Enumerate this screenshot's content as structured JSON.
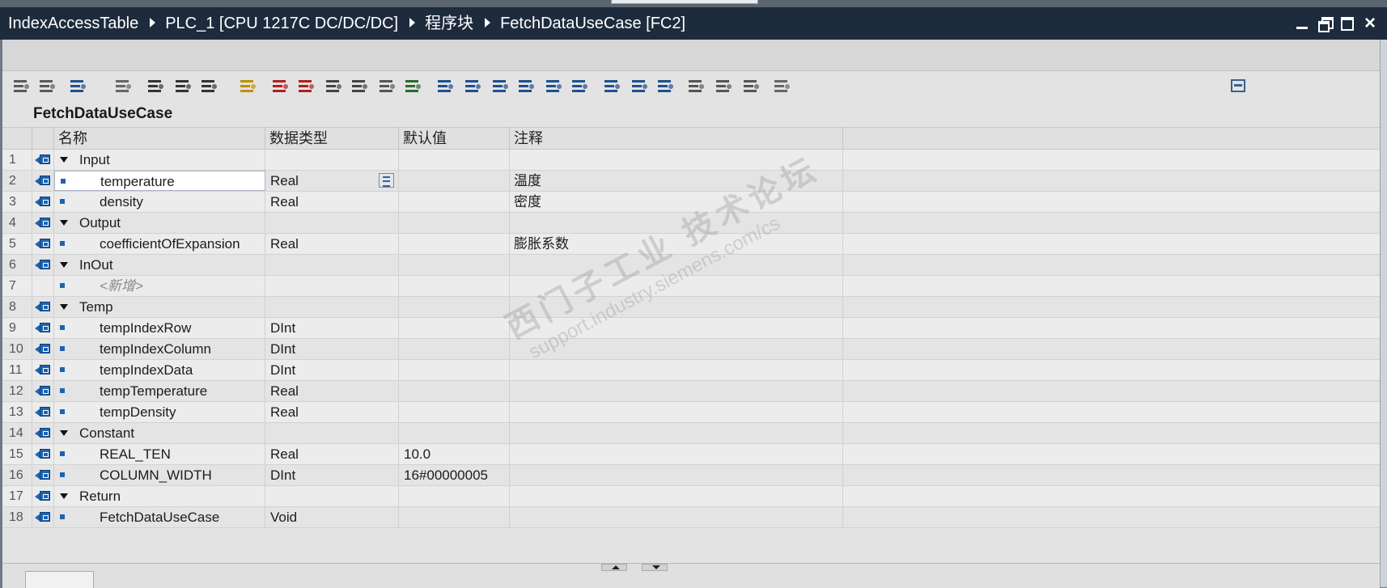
{
  "breadcrumb": [
    "IndexAccessTable",
    "PLC_1 [CPU 1217C DC/DC/DC]",
    "程序块",
    "FetchDataUseCase [FC2]"
  ],
  "block_name": "FetchDataUseCase",
  "columns": {
    "name": "名称",
    "type": "数据类型",
    "default": "默认值",
    "comment": "注释"
  },
  "rows": [
    {
      "num": "1",
      "kind": "group",
      "name": "Input",
      "type": "",
      "default": "",
      "comment": ""
    },
    {
      "num": "2",
      "kind": "var",
      "name": "temperature",
      "type": "Real",
      "default": "",
      "comment": "温度",
      "selected": true
    },
    {
      "num": "3",
      "kind": "var",
      "name": "density",
      "type": "Real",
      "default": "",
      "comment": "密度"
    },
    {
      "num": "4",
      "kind": "group",
      "name": "Output",
      "type": "",
      "default": "",
      "comment": ""
    },
    {
      "num": "5",
      "kind": "var",
      "name": "coefficientOfExpansion",
      "type": "Real",
      "default": "",
      "comment": "膨胀系数"
    },
    {
      "num": "6",
      "kind": "group",
      "name": "InOut",
      "type": "",
      "default": "",
      "comment": ""
    },
    {
      "num": "7",
      "kind": "new",
      "name": "<新增>",
      "type": "",
      "default": "",
      "comment": ""
    },
    {
      "num": "8",
      "kind": "group",
      "name": "Temp",
      "type": "",
      "default": "",
      "comment": ""
    },
    {
      "num": "9",
      "kind": "var",
      "name": "tempIndexRow",
      "type": "DInt",
      "default": "",
      "comment": ""
    },
    {
      "num": "10",
      "kind": "var",
      "name": "tempIndexColumn",
      "type": "DInt",
      "default": "",
      "comment": ""
    },
    {
      "num": "11",
      "kind": "var",
      "name": "tempIndexData",
      "type": "DInt",
      "default": "",
      "comment": ""
    },
    {
      "num": "12",
      "kind": "var",
      "name": "tempTemperature",
      "type": "Real",
      "default": "",
      "comment": ""
    },
    {
      "num": "13",
      "kind": "var",
      "name": "tempDensity",
      "type": "Real",
      "default": "",
      "comment": ""
    },
    {
      "num": "14",
      "kind": "group",
      "name": "Constant",
      "type": "",
      "default": "",
      "comment": ""
    },
    {
      "num": "15",
      "kind": "var",
      "name": "REAL_TEN",
      "type": "Real",
      "default": "10.0",
      "comment": ""
    },
    {
      "num": "16",
      "kind": "var",
      "name": "COLUMN_WIDTH",
      "type": "DInt",
      "default": "16#00000005",
      "comment": ""
    },
    {
      "num": "17",
      "kind": "group",
      "name": "Return",
      "type": "",
      "default": "",
      "comment": ""
    },
    {
      "num": "18",
      "kind": "var",
      "name": "FetchDataUseCase",
      "type": "Void",
      "default": "",
      "comment": ""
    }
  ],
  "watermark": {
    "line1": "西门子工业 技术论坛",
    "line2": "support.industry.siemens.com/cs"
  },
  "icons": {
    "toolbar": [
      "insert-row-icon",
      "add-row-icon",
      "export-icon",
      "db-call-icon",
      "list-icon",
      "list-edit-icon",
      "monitor-icon",
      "favorite-icon",
      "error-prev-icon",
      "error-next-icon",
      "copy-block-icon",
      "compare-icon",
      "indent-list-icon",
      "check-icon",
      "network-prev-icon",
      "indent-icon",
      "outdent-icon",
      "align-icon",
      "branch-open-icon",
      "branch-close-icon",
      "bookmark-icon",
      "jump-prev-icon",
      "jump-next-icon",
      "search-icon",
      "watch-table-icon",
      "watch-table-2-icon",
      "memory-icon"
    ],
    "interface": "interface-param-icon",
    "collapse": "collapse-triangle-icon",
    "variable": "variable-square-icon"
  },
  "colors": {
    "titlebar": "#1e2b3d",
    "param_icon": "#1f63b0"
  }
}
